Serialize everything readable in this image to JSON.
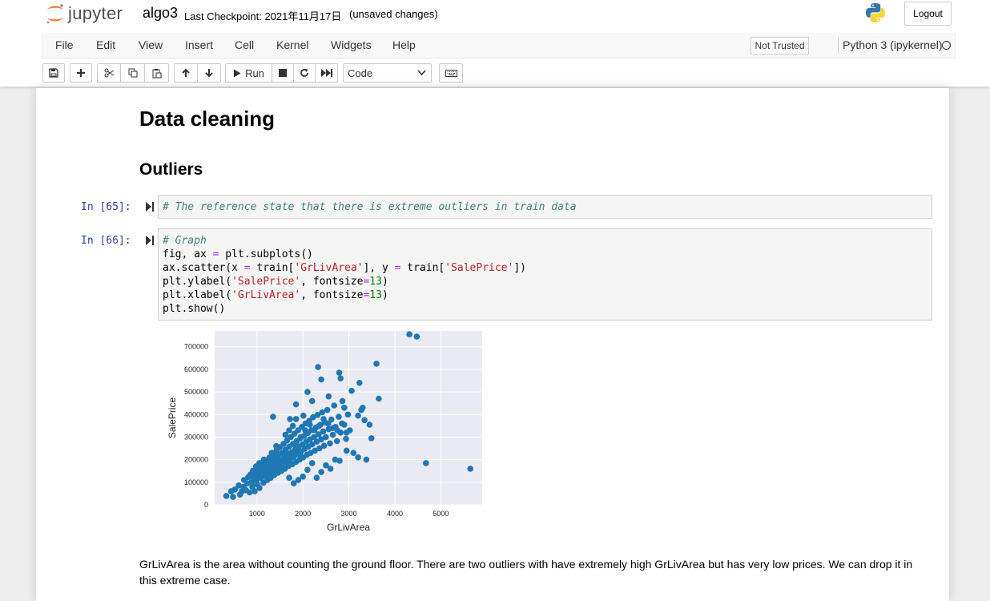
{
  "header": {
    "logo_text": "jupyter",
    "notebook_name": "algo3",
    "checkpoint": "Last Checkpoint: 2021年11月17日",
    "autosave_status": "(unsaved changes)",
    "logout_label": "Logout"
  },
  "menubar": {
    "items": [
      "File",
      "Edit",
      "View",
      "Insert",
      "Cell",
      "Kernel",
      "Widgets",
      "Help"
    ],
    "trusted_label": "Not Trusted",
    "kernel_name": "Python 3 (ipykernel)"
  },
  "toolbar": {
    "run_label": "Run",
    "cell_type": "Code",
    "icons": [
      "save-icon",
      "plus-icon",
      "cut-icon",
      "copy-icon",
      "paste-icon",
      "arrow-up-icon",
      "arrow-down-icon",
      "play-icon",
      "stop-icon",
      "restart-icon",
      "fast-forward-icon",
      "keyboard-icon"
    ]
  },
  "notebook": {
    "heading1": "Data cleaning",
    "heading2": "Outliers",
    "cell65": {
      "prompt": "In [65]:",
      "code": "# The reference state that there is extreme outliers in train data"
    },
    "cell66": {
      "prompt": "In [66]:",
      "lines": [
        "# Graph",
        "fig, ax = plt.subplots()",
        "ax.scatter(x = train['GrLivArea'], y = train['SalePrice'])",
        "plt.ylabel('SalePrice', fontsize=13)",
        "plt.xlabel('GrLivArea', fontsize=13)",
        "plt.show()"
      ]
    },
    "markdown": "GrLivArea is the area without counting the ground floor. There are two outliers with have extremely high GrLivArea but has very low prices. We can drop it in this extreme case."
  },
  "colors": {
    "accent": "#303f9f",
    "point": "#1f77b4",
    "plot_bg": "#eaeaf2"
  },
  "chart_data": {
    "type": "scatter",
    "title": "",
    "xlabel": "GrLivArea",
    "ylabel": "SalePrice",
    "xlim": [
      80,
      5900
    ],
    "ylim": [
      0,
      770000
    ],
    "xticks": [
      1000,
      2000,
      3000,
      4000,
      5000
    ],
    "yticks": [
      0,
      100000,
      200000,
      300000,
      400000,
      500000,
      600000,
      700000
    ],
    "grid": true,
    "points": [
      [
        334,
        39300
      ],
      [
        438,
        60000
      ],
      [
        480,
        35000
      ],
      [
        520,
        68000
      ],
      [
        605,
        86000
      ],
      [
        630,
        45000
      ],
      [
        672,
        60000
      ],
      [
        708,
        80000
      ],
      [
        720,
        110000
      ],
      [
        760,
        65000
      ],
      [
        790,
        95000
      ],
      [
        812,
        123000
      ],
      [
        840,
        55000
      ],
      [
        860,
        135000
      ],
      [
        880,
        100000
      ],
      [
        900,
        80000
      ],
      [
        912,
        150000
      ],
      [
        930,
        120000
      ],
      [
        950,
        60000
      ],
      [
        968,
        142000
      ],
      [
        990,
        110000
      ],
      [
        1004,
        92000
      ],
      [
        1020,
        165000
      ],
      [
        1040,
        130000
      ],
      [
        1056,
        75000
      ],
      [
        1072,
        154000
      ],
      [
        1092,
        118000
      ],
      [
        1110,
        180000
      ],
      [
        1126,
        140000
      ],
      [
        1140,
        98000
      ],
      [
        1160,
        168000
      ],
      [
        1176,
        128000
      ],
      [
        1190,
        195000
      ],
      [
        1208,
        150000
      ],
      [
        1224,
        110000
      ],
      [
        1240,
        178000
      ],
      [
        1256,
        138000
      ],
      [
        1272,
        210000
      ],
      [
        1288,
        160000
      ],
      [
        1300,
        120000
      ],
      [
        1316,
        190000
      ],
      [
        1332,
        145000
      ],
      [
        1348,
        225000
      ],
      [
        1362,
        172000
      ],
      [
        1378,
        132000
      ],
      [
        1392,
        205000
      ],
      [
        1408,
        158000
      ],
      [
        1424,
        240000
      ],
      [
        1440,
        185000
      ],
      [
        1456,
        142000
      ],
      [
        1470,
        218000
      ],
      [
        1486,
        168000
      ],
      [
        1500,
        255000
      ],
      [
        1516,
        195000
      ],
      [
        1532,
        150000
      ],
      [
        1546,
        230000
      ],
      [
        1562,
        180000
      ],
      [
        1578,
        270000
      ],
      [
        1592,
        208000
      ],
      [
        1608,
        160000
      ],
      [
        1624,
        245000
      ],
      [
        1640,
        190000
      ],
      [
        1656,
        285000
      ],
      [
        1672,
        220000
      ],
      [
        1688,
        172000
      ],
      [
        1704,
        258000
      ],
      [
        1720,
        200000
      ],
      [
        1736,
        300000
      ],
      [
        1752,
        232000
      ],
      [
        1768,
        180000
      ],
      [
        1784,
        270000
      ],
      [
        1800,
        212000
      ],
      [
        1816,
        315000
      ],
      [
        1832,
        245000
      ],
      [
        1848,
        190000
      ],
      [
        1864,
        282000
      ],
      [
        1880,
        225000
      ],
      [
        1896,
        330000
      ],
      [
        1912,
        258000
      ],
      [
        1928,
        200000
      ],
      [
        1944,
        295000
      ],
      [
        1960,
        236000
      ],
      [
        1976,
        345000
      ],
      [
        1992,
        268000
      ],
      [
        2008,
        210000
      ],
      [
        2024,
        305000
      ],
      [
        2040,
        248000
      ],
      [
        2056,
        360000
      ],
      [
        2072,
        280000
      ],
      [
        2088,
        222000
      ],
      [
        2104,
        318000
      ],
      [
        2120,
        258000
      ],
      [
        2136,
        372000
      ],
      [
        2152,
        290000
      ],
      [
        2168,
        230000
      ],
      [
        2184,
        330000
      ],
      [
        2200,
        268000
      ],
      [
        2220,
        388000
      ],
      [
        2240,
        300000
      ],
      [
        2260,
        240000
      ],
      [
        2280,
        342000
      ],
      [
        2300,
        280000
      ],
      [
        2320,
        398000
      ],
      [
        2340,
        312000
      ],
      [
        2360,
        250000
      ],
      [
        2380,
        355000
      ],
      [
        2400,
        290000
      ],
      [
        2420,
        410000
      ],
      [
        2440,
        325000
      ],
      [
        2460,
        262000
      ],
      [
        2480,
        365000
      ],
      [
        2500,
        300000
      ],
      [
        2530,
        420000
      ],
      [
        2560,
        335000
      ],
      [
        2590,
        272000
      ],
      [
        2620,
        378000
      ],
      [
        2650,
        310000
      ],
      [
        2680,
        440000
      ],
      [
        2710,
        345000
      ],
      [
        2740,
        282000
      ],
      [
        2780,
        390000
      ],
      [
        2820,
        320000
      ],
      [
        2860,
        460000
      ],
      [
        2900,
        355000
      ],
      [
        2940,
        292000
      ],
      [
        2980,
        400000
      ],
      [
        3020,
        330000
      ],
      [
        1200,
        130000
      ],
      [
        1300,
        150000
      ],
      [
        1400,
        170000
      ],
      [
        1500,
        180000
      ],
      [
        1600,
        200000
      ],
      [
        1700,
        210000
      ],
      [
        1800,
        230000
      ],
      [
        1900,
        240000
      ],
      [
        1250,
        165000
      ],
      [
        1350,
        140000
      ],
      [
        1450,
        195000
      ],
      [
        1550,
        160000
      ],
      [
        1650,
        230000
      ],
      [
        1750,
        185000
      ],
      [
        1850,
        260000
      ],
      [
        1950,
        215000
      ],
      [
        1100,
        150000
      ],
      [
        1000,
        135000
      ],
      [
        980,
        170000
      ],
      [
        1150,
        200000
      ],
      [
        1050,
        185000
      ],
      [
        1320,
        230000
      ],
      [
        1420,
        260000
      ],
      [
        1620,
        310000
      ],
      [
        1700,
        330000
      ],
      [
        1780,
        350000
      ],
      [
        1850,
        380000
      ],
      [
        1950,
        300000
      ],
      [
        2050,
        330000
      ],
      [
        2150,
        355000
      ],
      [
        2250,
        330000
      ],
      [
        2350,
        350000
      ],
      [
        2450,
        380000
      ],
      [
        2550,
        360000
      ],
      [
        2650,
        340000
      ],
      [
        2750,
        330000
      ],
      [
        2850,
        360000
      ],
      [
        2950,
        320000
      ],
      [
        1350,
        390000
      ],
      [
        1720,
        380000
      ],
      [
        2010,
        395000
      ],
      [
        1850,
        445000
      ],
      [
        2100,
        500000
      ],
      [
        2200,
        460000
      ],
      [
        2330,
        610000
      ],
      [
        2400,
        555000
      ],
      [
        2560,
        480000
      ],
      [
        2790,
        585000
      ],
      [
        2820,
        560000
      ],
      [
        2900,
        430000
      ],
      [
        3060,
        505000
      ],
      [
        3200,
        395000
      ],
      [
        3230,
        540000
      ],
      [
        3270,
        420000
      ],
      [
        3300,
        430000
      ],
      [
        3340,
        375000
      ],
      [
        3450,
        355000
      ],
      [
        3490,
        295000
      ],
      [
        3600,
        625000
      ],
      [
        3650,
        470000
      ],
      [
        3380,
        200000
      ],
      [
        3200,
        210000
      ],
      [
        3100,
        230000
      ],
      [
        2950,
        240000
      ],
      [
        2800,
        195000
      ],
      [
        2700,
        200000
      ],
      [
        2600,
        160000
      ],
      [
        2500,
        175000
      ],
      [
        2400,
        145000
      ],
      [
        2300,
        120000
      ],
      [
        2200,
        185000
      ],
      [
        2100,
        155000
      ],
      [
        2000,
        125000
      ],
      [
        1900,
        110000
      ],
      [
        1800,
        95000
      ],
      [
        1700,
        120000
      ],
      [
        4316,
        755000
      ],
      [
        4476,
        745000
      ],
      [
        4676,
        184750
      ],
      [
        5642,
        160000
      ]
    ]
  }
}
